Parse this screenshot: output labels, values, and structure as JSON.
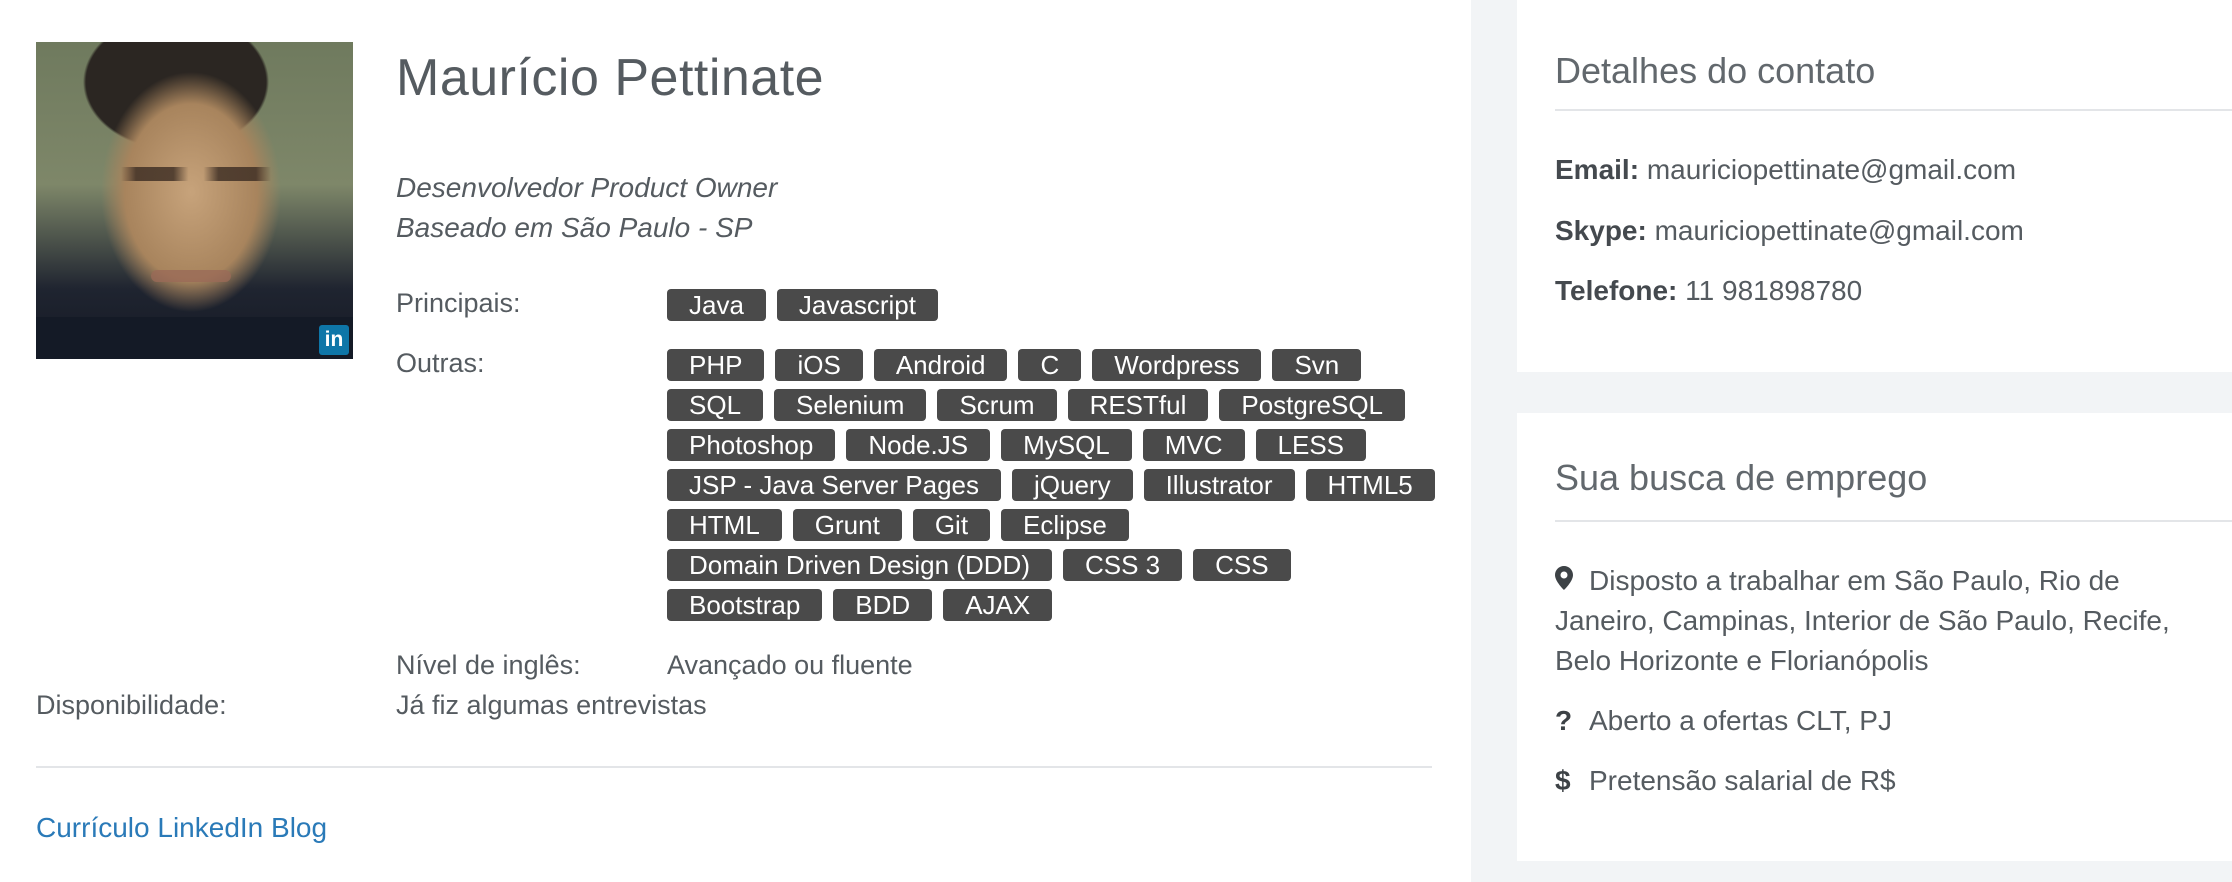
{
  "profile": {
    "name": "Maurício Pettinate",
    "role": "Desenvolvedor Product Owner",
    "location": "Baseado em São Paulo - SP",
    "linkedin_badge": "in"
  },
  "skills": {
    "main_label": "Principais:",
    "main": [
      "Java",
      "Javascript"
    ],
    "other_label": "Outras:",
    "other": [
      "PHP",
      "iOS",
      "Android",
      "C",
      "Wordpress",
      "Svn",
      "SQL",
      "Selenium",
      "Scrum",
      "RESTful",
      "PostgreSQL",
      "Photoshop",
      "Node.JS",
      "MySQL",
      "MVC",
      "LESS",
      "JSP - Java Server Pages",
      "jQuery",
      "Illustrator",
      "HTML5",
      "HTML",
      "Grunt",
      "Git",
      "Eclipse",
      "Domain Driven Design (DDD)",
      "CSS 3",
      "CSS",
      "Bootstrap",
      "BDD",
      "AJAX"
    ]
  },
  "english": {
    "label": "Nível de inglês:",
    "value": "Avançado ou fluente"
  },
  "availability": {
    "label": "Disponibilidade:",
    "value": "Já fiz algumas entrevistas"
  },
  "links": {
    "curriculo": "Currículo",
    "linkedin": "LinkedIn",
    "blog": "Blog"
  },
  "contact": {
    "title": "Detalhes do contato",
    "email_label": "Email:",
    "email": "mauriciopettinate@gmail.com",
    "skype_label": "Skype:",
    "skype": "mauriciopettinate@gmail.com",
    "phone_label": "Telefone:",
    "phone": "11 981898780"
  },
  "job_search": {
    "title": "Sua busca de emprego",
    "locations": "Disposto a trabalhar em São Paulo, Rio de Janeiro, Campinas, Interior de São Paulo, Recife, Belo Horizonte e Florianópolis",
    "contract": "Aberto a ofertas CLT, PJ",
    "salary": "Pretensão salarial de R$",
    "icons": [
      "map-marker-icon",
      "question-icon",
      "dollar-icon"
    ]
  },
  "colors": {
    "tag_bg": "#4a4a4a",
    "link": "#2a7ab8",
    "text": "#555b60",
    "page_bg": "#f2f4f6"
  }
}
